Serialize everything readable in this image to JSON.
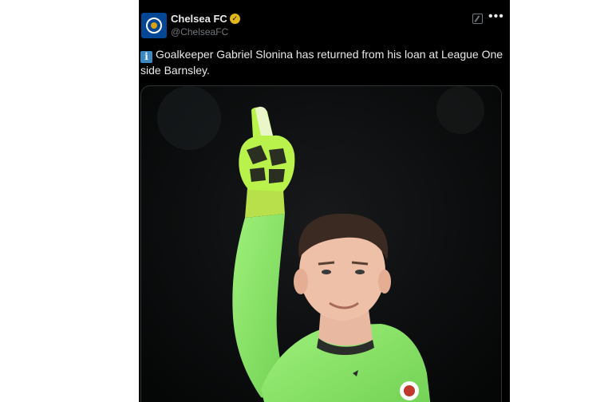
{
  "tweet": {
    "author_name": "Chelsea FC",
    "handle": "@ChelseaFC",
    "verified_badge": "✓",
    "info_emoji": "i",
    "text": "Goalkeeper Gabriel Slonina has returned from his loan at League One side Barnsley.",
    "more_icon": "•••",
    "brand_color": "#034694",
    "badge_color": "#e2b719"
  },
  "media": {
    "icon": "photo"
  }
}
